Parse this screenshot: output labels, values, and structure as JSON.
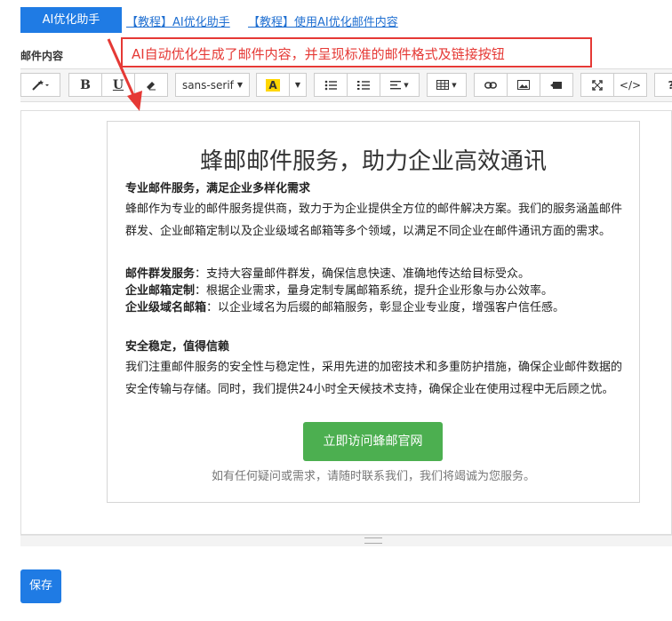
{
  "top": {
    "ai_button": "AI优化助手",
    "tutorial_link_1": "【教程】AI优化助手",
    "tutorial_link_2": "【教程】使用AI优化邮件内容"
  },
  "field_label": "邮件内容",
  "annotation": {
    "text": "AI自动优化生成了邮件内容，并呈现标准的邮件格式及链接按钮",
    "color": "#e53935"
  },
  "toolbar": {
    "font_name": "sans-serif",
    "bold": "B",
    "underline": "U",
    "color_letter": "A",
    "code": "</>",
    "help": "?"
  },
  "email": {
    "title": "蜂邮邮件服务，助力企业高效通讯",
    "h1": "专业邮件服务，满足企业多样化需求",
    "p1": "蜂邮作为专业的邮件服务提供商，致力于为企业提供全方位的邮件解决方案。我们的服务涵盖邮件群发、企业邮箱定制以及企业级域名邮箱等多个领域，以满足不同企业在邮件通讯方面的需求。",
    "items": [
      {
        "label": "邮件群发服务",
        "text": "：支持大容量邮件群发，确保信息快速、准确地传达给目标受众。"
      },
      {
        "label": "企业邮箱定制",
        "text": "：根据企业需求，量身定制专属邮箱系统，提升企业形象与办公效率。"
      },
      {
        "label": "企业级域名邮箱",
        "text": "：以企业域名为后缀的邮箱服务，彰显企业专业度，增强客户信任感。"
      }
    ],
    "h2": "安全稳定，值得信赖",
    "p2": "我们注重邮件服务的安全性与稳定性，采用先进的加密技术和多重防护措施，确保企业邮件数据的安全传输与存储。同时，我们提供24小时全天候技术支持，确保企业在使用过程中无后顾之忧。",
    "cta": "立即访问蜂邮官网",
    "footer": "如有任何疑问或需求，请随时联系我们，我们将竭诚为您服务。"
  },
  "save_button": "保存",
  "colors": {
    "primary": "#1f7be4",
    "cta_green": "#4caf50",
    "highlight_yellow": "#ffd600"
  }
}
